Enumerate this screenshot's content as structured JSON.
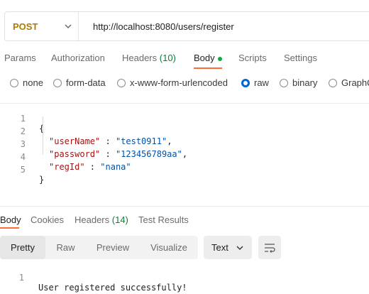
{
  "request": {
    "method": "POST",
    "url": "http://localhost:8080/users/register"
  },
  "request_tabs": [
    {
      "label": "Params"
    },
    {
      "label": "Authorization"
    },
    {
      "label": "Headers",
      "count": "(10)"
    },
    {
      "label": "Body",
      "active": true
    },
    {
      "label": "Scripts"
    },
    {
      "label": "Settings"
    }
  ],
  "body_types": [
    {
      "label": "none",
      "selected": false
    },
    {
      "label": "form-data",
      "selected": false
    },
    {
      "label": "x-www-form-urlencoded",
      "selected": false
    },
    {
      "label": "raw",
      "selected": true
    },
    {
      "label": "binary",
      "selected": false
    },
    {
      "label": "GraphQ",
      "selected": false
    }
  ],
  "editor": {
    "line_numbers": [
      "1",
      "2",
      "3",
      "4",
      "5"
    ],
    "open_brace": "{",
    "close_brace": "}",
    "fields": [
      {
        "key": "\"userName\"",
        "sep": " : ",
        "value": "\"test0911\"",
        "comma": ","
      },
      {
        "key": "\"password\"",
        "sep": " : ",
        "value": "\"123456789aa\"",
        "comma": ","
      },
      {
        "key": "\"regId\"",
        "sep": " : ",
        "value": "\"nana\"",
        "comma": ""
      }
    ]
  },
  "response_tabs": [
    {
      "label": "Body",
      "active": true
    },
    {
      "label": "Cookies"
    },
    {
      "label": "Headers",
      "count": "(14)"
    },
    {
      "label": "Test Results"
    }
  ],
  "response_view": {
    "modes": [
      "Pretty",
      "Raw",
      "Preview",
      "Visualize"
    ],
    "active_mode": "Pretty",
    "format": "Text"
  },
  "response_body": {
    "line_number": "1",
    "text": "User registered successfully!"
  },
  "colors": {
    "accent": "#ff6c37",
    "method_post": "#ad7a03",
    "radio_selected": "#0265d2",
    "status_dot": "#0caa41"
  }
}
